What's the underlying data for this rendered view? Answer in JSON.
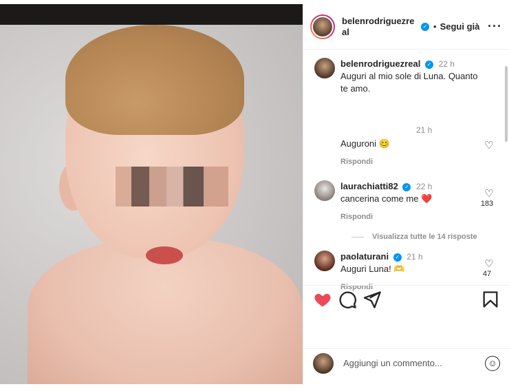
{
  "post": {
    "author": "belenrodriguezreal",
    "header_username": "belenrodriguezre al",
    "follow_label": "Segui già",
    "dot": "•",
    "more": "···"
  },
  "comments": [
    {
      "user": "belenrodriguezreal",
      "time": "22 h",
      "text": "Auguri al mio sole di Luna. Quanto te amo."
    },
    {
      "user": "",
      "time": "21 h",
      "text": "Auguroni 😊",
      "reply": "Rispondi"
    },
    {
      "user": "laurachiatti82",
      "time": "22 h",
      "text": "cancerina come me ❤️",
      "reply": "Rispondi",
      "likes": "183"
    },
    {
      "user": "paolaturani",
      "time": "21 h",
      "text": "Auguri Luna! 🫶",
      "reply": "Rispondi",
      "likes": "47"
    }
  ],
  "view_all_replies": "Visualizza tutte le 14 risposte",
  "add_comment_placeholder": "Aggiungi un commento...",
  "colors": {
    "verified": "#0095f6",
    "like_red": "#ed4956",
    "muted": "#8e8e8e"
  },
  "icons": [
    "heart-icon",
    "comment-icon",
    "share-icon",
    "bookmark-icon",
    "emoji-icon",
    "more-icon"
  ]
}
